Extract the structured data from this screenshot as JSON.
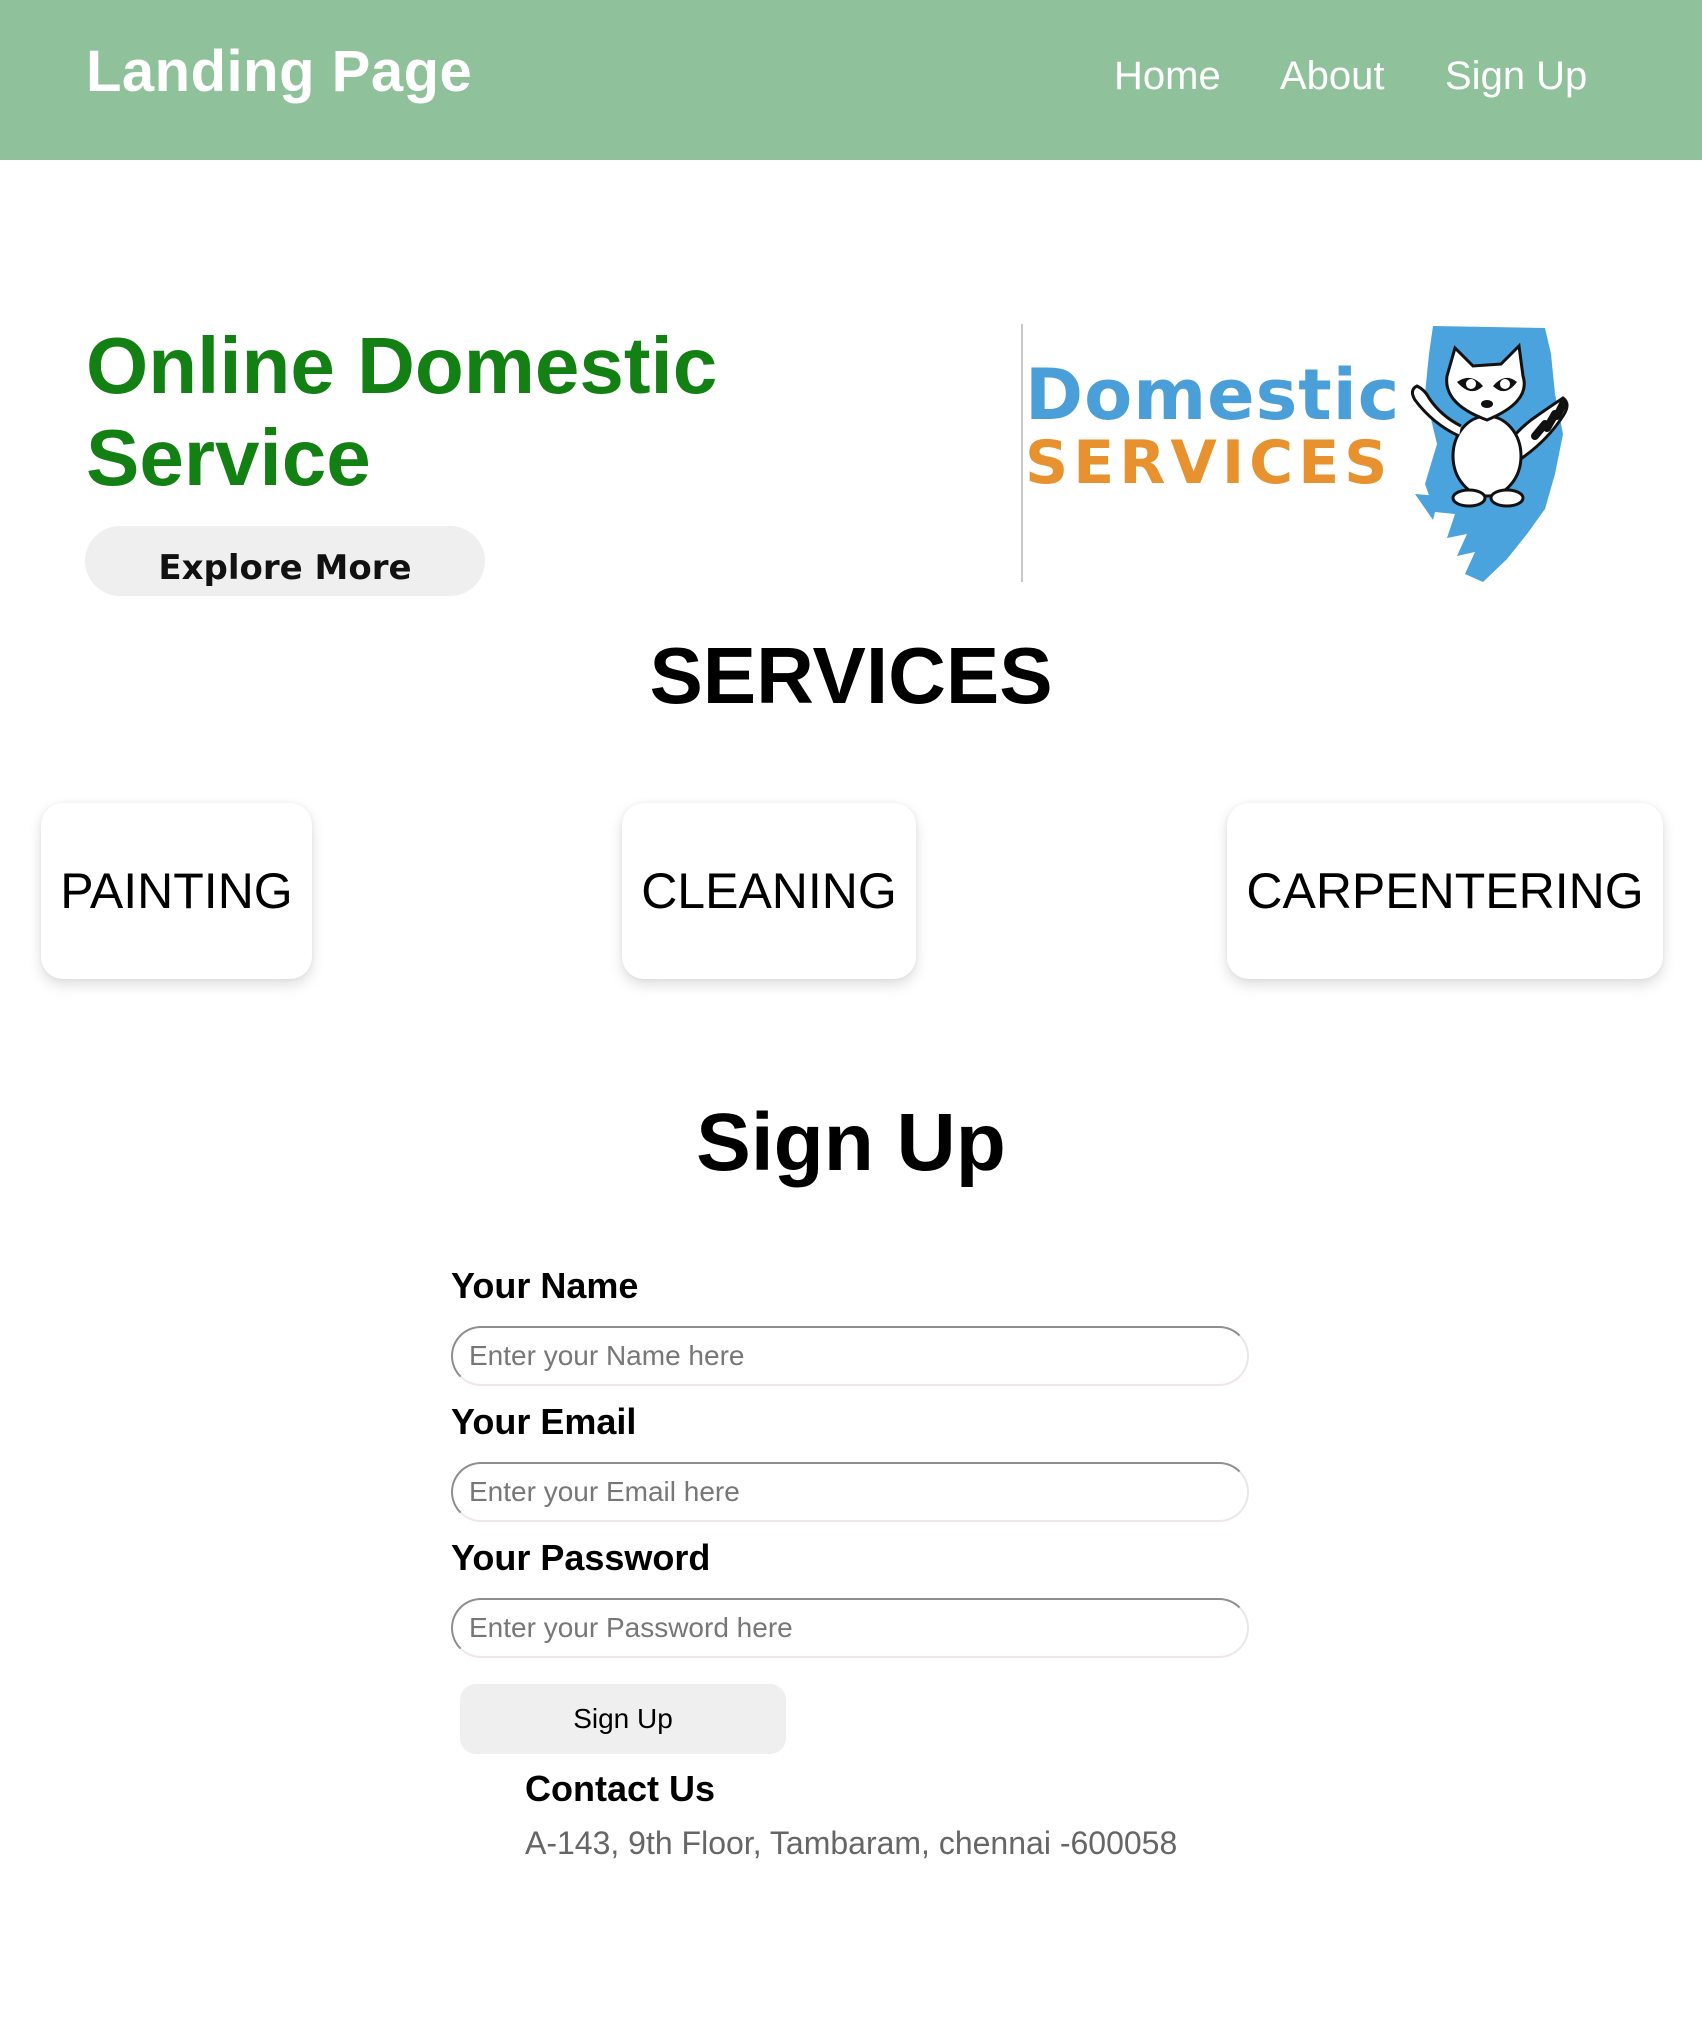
{
  "navbar": {
    "brand": "Landing Page",
    "links": [
      "Home",
      "About",
      "Sign Up"
    ]
  },
  "hero": {
    "title_line1": "Online Domestic",
    "title_line2": "Service",
    "button_label": "Explore More",
    "logo": {
      "word1": "Domestic",
      "word2": "SERVICES",
      "colors": {
        "word1": "#4a9fd8",
        "word2": "#e7922f",
        "splash": "#4aa3dc"
      }
    }
  },
  "services": {
    "title": "SERVICES",
    "items": [
      "PAINTING",
      "CLEANING",
      "CARPENTERING"
    ]
  },
  "signup": {
    "title": "Sign Up",
    "fields": [
      {
        "label": "Your Name",
        "placeholder": "Enter your Name here",
        "value": ""
      },
      {
        "label": "Your Email",
        "placeholder": "Enter your Email here",
        "value": ""
      },
      {
        "label": "Your Password",
        "placeholder": "Enter your Password here",
        "value": ""
      }
    ],
    "submit_label": "Sign Up"
  },
  "contact": {
    "title": "Contact Us",
    "address": "A-143, 9th Floor, Tambaram, chennai -600058"
  },
  "colors": {
    "navbar_bg": "#8fc29a",
    "hero_title": "#128012",
    "button_bg": "#efefef"
  }
}
